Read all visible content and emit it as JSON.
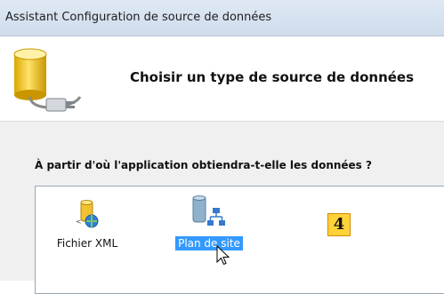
{
  "window": {
    "title": "Assistant Configuration de source de données"
  },
  "header": {
    "title": "Choisir un type de source de données",
    "icon": "database-plug-icon"
  },
  "prompt": {
    "question": "À partir d'où l'application obtiendra-t-elle les données ?"
  },
  "source_types": [
    {
      "label": "Fichier XML",
      "icon": "xml-file-globe-icon",
      "selected": false
    },
    {
      "label": "Plan de site",
      "icon": "sitemap-icon",
      "selected": true
    }
  ],
  "annotation": {
    "step_number": "4"
  },
  "colors": {
    "selection": "#3399ff",
    "badge": "#ffd23a",
    "titlebar": "#dfe9f5"
  }
}
